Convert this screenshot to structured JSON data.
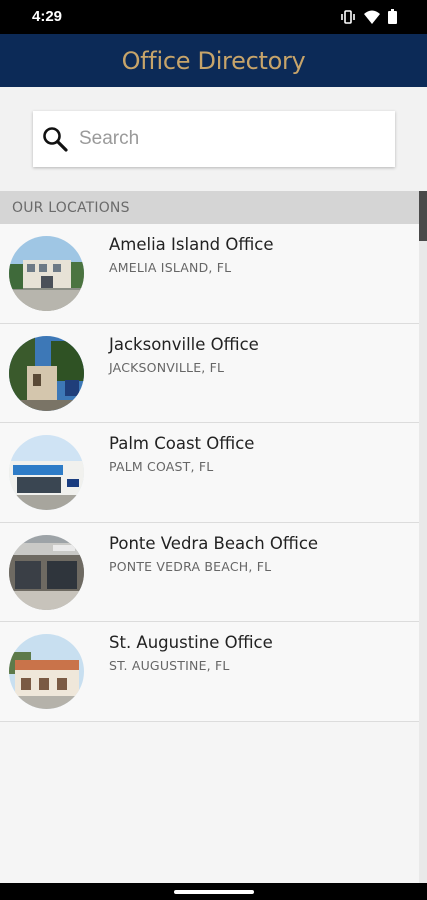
{
  "status": {
    "time": "4:29"
  },
  "app": {
    "title": "Office Directory"
  },
  "search": {
    "placeholder": "Search"
  },
  "section": {
    "label": "OUR LOCATIONS"
  },
  "offices": [
    {
      "name": "Amelia Island Office",
      "location": "AMELIA ISLAND, FL"
    },
    {
      "name": "Jacksonville Office",
      "location": "JACKSONVILLE, FL"
    },
    {
      "name": "Palm Coast Office",
      "location": "PALM COAST, FL"
    },
    {
      "name": "Ponte Vedra Beach Office",
      "location": "PONTE VEDRA BEACH, FL"
    },
    {
      "name": "St. Augustine Office",
      "location": "ST. AUGUSTINE, FL"
    }
  ],
  "colors": {
    "app_bar": "#0c2a57",
    "title": "#c7a46a",
    "section_bg": "#d5d5d5"
  },
  "icons": [
    "vibrate-icon",
    "wifi-icon",
    "battery-icon",
    "search-icon"
  ]
}
